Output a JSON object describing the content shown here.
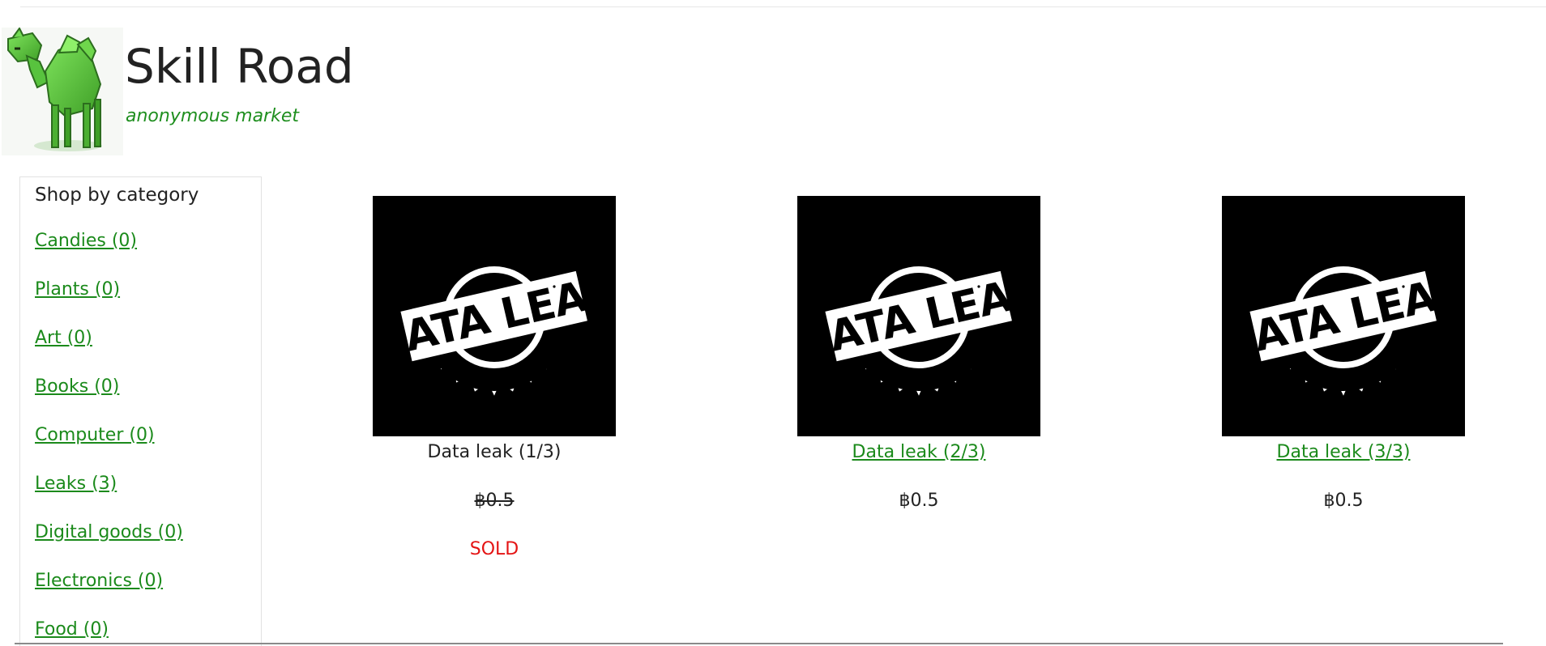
{
  "site": {
    "title": "Skill Road",
    "tagline": "anonymous market"
  },
  "sidebar": {
    "heading": "Shop by category",
    "items": [
      {
        "label": "Candies (0)"
      },
      {
        "label": "Plants (0)"
      },
      {
        "label": "Art (0)"
      },
      {
        "label": "Books (0)"
      },
      {
        "label": "Computer (0)"
      },
      {
        "label": "Leaks (3)"
      },
      {
        "label": "Digital goods (0)"
      },
      {
        "label": "Electronics (0)"
      },
      {
        "label": "Food (0)"
      }
    ]
  },
  "products": [
    {
      "image_text": "DATA LEAK",
      "title": "Data leak (1/3)",
      "price": "฿0.5",
      "status": "SOLD",
      "sold": true
    },
    {
      "image_text": "DATA LEAK",
      "title": "Data leak (2/3)",
      "price": "฿0.5",
      "status": "",
      "sold": false
    },
    {
      "image_text": "DATA LEAK",
      "title": "Data leak (3/3)",
      "price": "฿0.5",
      "status": "",
      "sold": false
    }
  ],
  "icons": {
    "logo": "camel-logo-icon"
  },
  "colors": {
    "link": "#1b8a1b",
    "tagline": "#1f8f1f",
    "sold": "#e41414",
    "image_background": "#000000"
  }
}
